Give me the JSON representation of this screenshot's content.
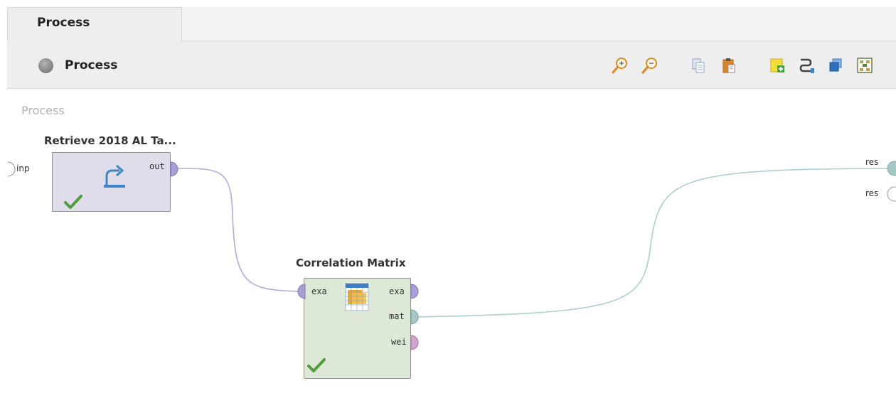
{
  "tab": {
    "label": "Process"
  },
  "toolbar": {
    "breadcrumb": "Process",
    "buttons": [
      "zoom-in-icon",
      "zoom-out-icon",
      "copy-icon",
      "paste-icon",
      "add-note-icon",
      "auto-wire-icon",
      "layers-icon",
      "fit-view-icon"
    ]
  },
  "canvas": {
    "label": "Process",
    "process_ports": {
      "input": "inp",
      "outputs": [
        "res",
        "res"
      ]
    },
    "operators": {
      "retrieve": {
        "title": "Retrieve 2018 AL Ta...",
        "ports_out": [
          "out"
        ]
      },
      "correlation": {
        "title": "Correlation Matrix",
        "ports_in": [
          "exa"
        ],
        "ports_out": [
          "exa",
          "mat",
          "wei"
        ]
      }
    }
  },
  "colors": {
    "wire_example_set": "#b3a9de",
    "wire_matrix": "#a9d1cf",
    "port_example_set": "#a99fd6",
    "port_matrix": "#a3c8c6",
    "port_weights": "#d2a3cf",
    "check": "#4f9c3a"
  }
}
